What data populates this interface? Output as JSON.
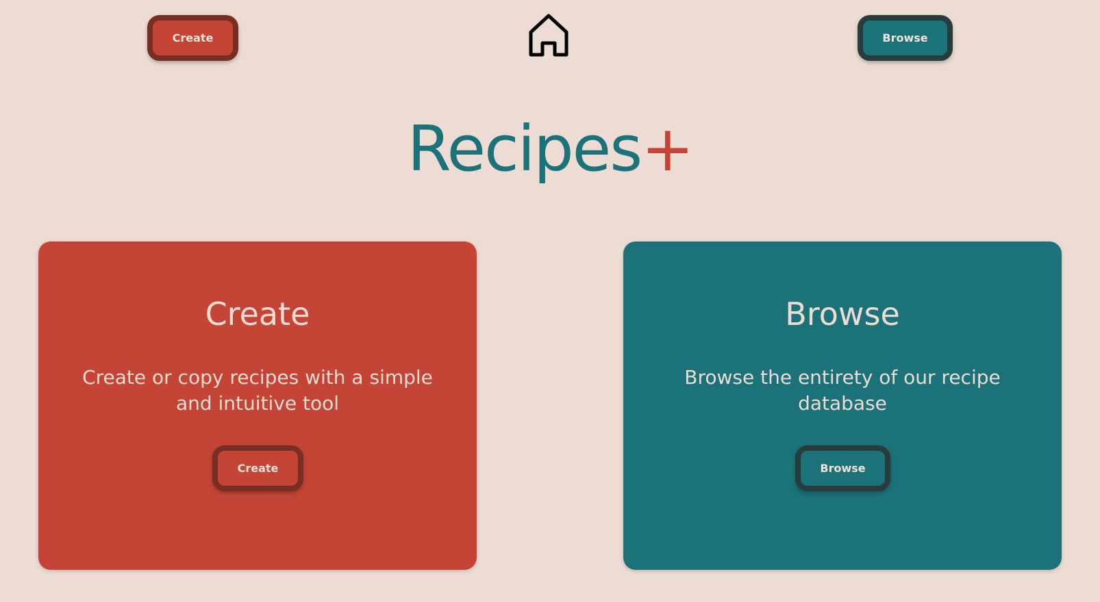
{
  "nav": {
    "create_label": "Create",
    "browse_label": "Browse",
    "home_icon": "home-icon"
  },
  "title": {
    "main": "Recipes",
    "accent": "+"
  },
  "cards": {
    "create": {
      "heading": "Create",
      "description": "Create or copy recipes with a simple and intuitive tool",
      "button_label": "Create"
    },
    "browse": {
      "heading": "Browse",
      "description": "Browse the entirety of our recipe database",
      "button_label": "Browse"
    }
  },
  "colors": {
    "background": "#eddcd4",
    "primary_red": "#c44536",
    "dark_red": "#772e25",
    "primary_teal": "#1b7278",
    "dark_teal": "#283d3b",
    "light_text": "#eddcd4"
  }
}
